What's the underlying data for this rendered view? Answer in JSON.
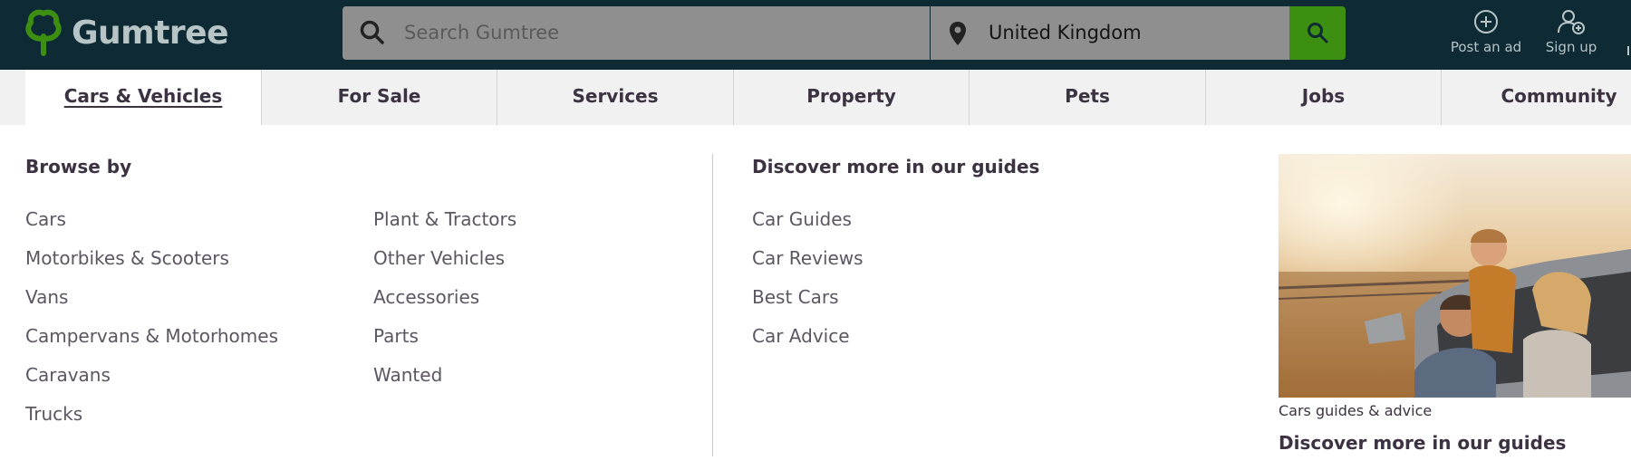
{
  "header": {
    "logo_text": "Gumtree",
    "search_placeholder": "Search Gumtree",
    "location": "United Kingdom",
    "post_ad_label": "Post an ad",
    "sign_up_label": "Sign up"
  },
  "nav": {
    "tabs": [
      {
        "label": "Cars & Vehicles",
        "active": true
      },
      {
        "label": "For Sale"
      },
      {
        "label": "Services"
      },
      {
        "label": "Property"
      },
      {
        "label": "Pets"
      },
      {
        "label": "Jobs"
      },
      {
        "label": "Community"
      }
    ]
  },
  "browse": {
    "heading": "Browse by",
    "col1": [
      "Cars",
      "Motorbikes & Scooters",
      "Vans",
      "Campervans & Motorhomes",
      "Caravans",
      "Trucks"
    ],
    "col2": [
      "Plant & Tractors",
      "Other Vehicles",
      "Accessories",
      "Parts",
      "Wanted"
    ]
  },
  "guides": {
    "heading": "Discover more in our guides",
    "links": [
      "Car Guides",
      "Car Reviews",
      "Best Cars",
      "Car Advice"
    ]
  },
  "promo": {
    "caption": "Cars guides & advice",
    "link": "Discover more in our guides"
  },
  "colors": {
    "header_bg": "#0d2a35",
    "accent_green": "#3d8f12",
    "nav_bg": "#f1f1f1",
    "text": "#3c3241"
  }
}
